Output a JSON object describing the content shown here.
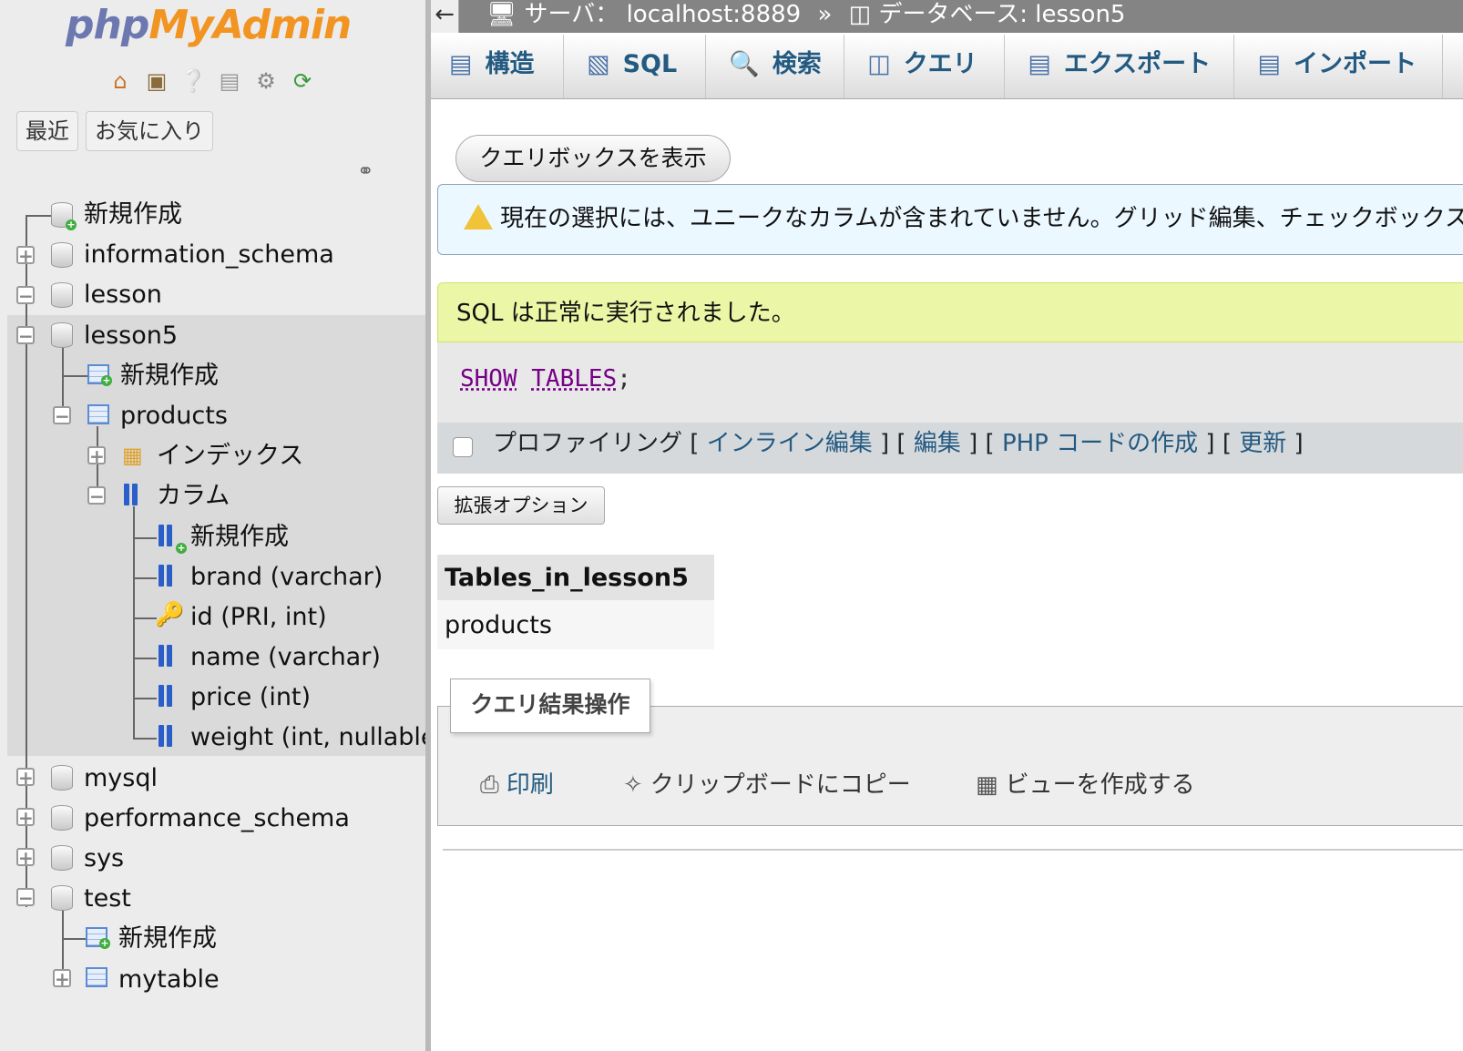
{
  "sidebar": {
    "logo_php": "php",
    "logo_myadmin": "MyAdmin",
    "nav_icons": [
      "home-icon",
      "logout-icon",
      "help-icon",
      "docs-icon",
      "settings-icon",
      "reload-icon"
    ],
    "tab_recent": "最近",
    "tab_favorites": "お気に入り",
    "tree": {
      "new": "新規作成",
      "db_information_schema": "information_schema",
      "db_lesson": "lesson",
      "db_lesson5": "lesson5",
      "lesson5_new": "新規作成",
      "table_products": "products",
      "indexes": "インデックス",
      "columns": "カラム",
      "columns_new": "新規作成",
      "col_brand": "brand (varchar)",
      "col_id": "id (PRI, int)",
      "col_name": "name (varchar)",
      "col_price": "price (int)",
      "col_weight": "weight (int, nullable)",
      "db_mysql": "mysql",
      "db_performance_schema": "performance_schema",
      "db_sys": "sys",
      "db_test": "test",
      "test_new": "新規作成",
      "table_mytable": "mytable"
    }
  },
  "breadcrumb": {
    "back": "←",
    "server_label": "サーバ：",
    "server": "localhost:8889",
    "sep": "»",
    "db_label": "データベース:",
    "db": "lesson5"
  },
  "tabs": {
    "structure": "構造",
    "sql": "SQL",
    "search": "検索",
    "query": "クエリ",
    "export": "エクスポート",
    "import": "インポート"
  },
  "main": {
    "show_query_box": "クエリボックスを表示",
    "notice": "現在の選択には、ユニークなカラムが含まれていません。グリッド編集、チェックボックス",
    "success": "SQL は正常に実行されました。",
    "sql_kw1": "SHOW",
    "sql_kw2": "TABLES",
    "sql_end": ";",
    "profiling": "プロファイリング",
    "bracket_open": "[",
    "bracket_close": "]",
    "link_inline_edit": "インライン編集",
    "link_edit": "編集",
    "link_php_code": "PHP コードの作成",
    "link_refresh": "更新",
    "extra_options": "拡張オプション",
    "result_header": "Tables_in_lesson5",
    "result_rows": [
      "products"
    ],
    "ops_legend": "クエリ結果操作",
    "op_print": "印刷",
    "op_copy": "クリップボードにコピー",
    "op_view": "ビューを作成する"
  }
}
